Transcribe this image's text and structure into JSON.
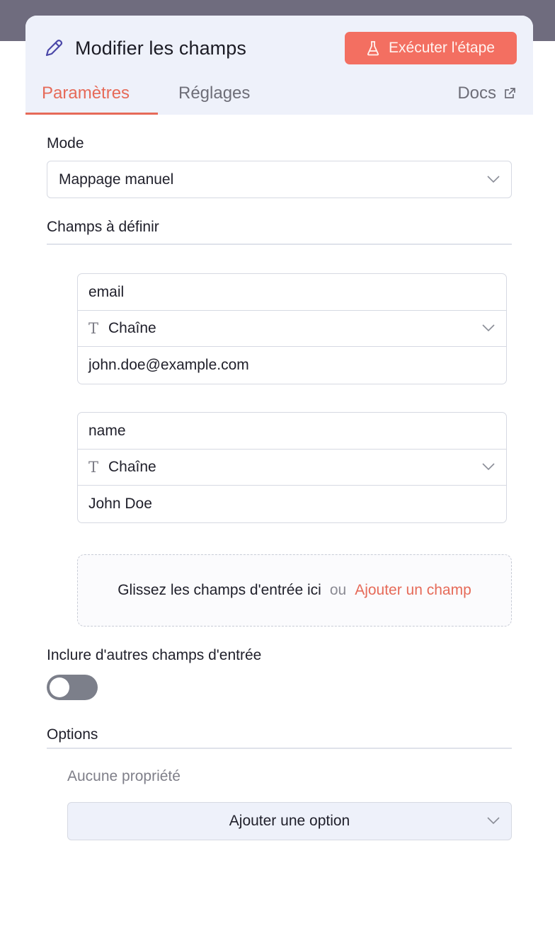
{
  "header": {
    "title": "Modifier les champs",
    "run_button_label": "Exécuter l'étape"
  },
  "tabs": {
    "parameters": "Paramètres",
    "settings": "Réglages",
    "docs": "Docs"
  },
  "mode": {
    "label": "Mode",
    "value": "Mappage manuel"
  },
  "fields_section": {
    "label": "Champs à définir",
    "fields": [
      {
        "name": "email",
        "type": "Chaîne",
        "value": "john.doe@example.com"
      },
      {
        "name": "name",
        "type": "Chaîne",
        "value": "John Doe"
      }
    ],
    "dropzone_text": "Glissez les champs d'entrée ici",
    "or_text": "ou",
    "add_field_label": "Ajouter un champ"
  },
  "include_other": {
    "label": "Inclure d'autres champs d'entrée",
    "enabled": false
  },
  "options": {
    "label": "Options",
    "empty_text": "Aucune propriété",
    "add_option_label": "Ajouter une option"
  },
  "colors": {
    "accent": "#f36f61",
    "tab_active": "#e66a58",
    "header_bg": "#eef1fa"
  },
  "icons": {
    "title": "pencil-icon",
    "run": "flask-icon",
    "docs": "external-link-icon",
    "type": "text-type-icon",
    "dropdown": "chevron-down-icon"
  }
}
